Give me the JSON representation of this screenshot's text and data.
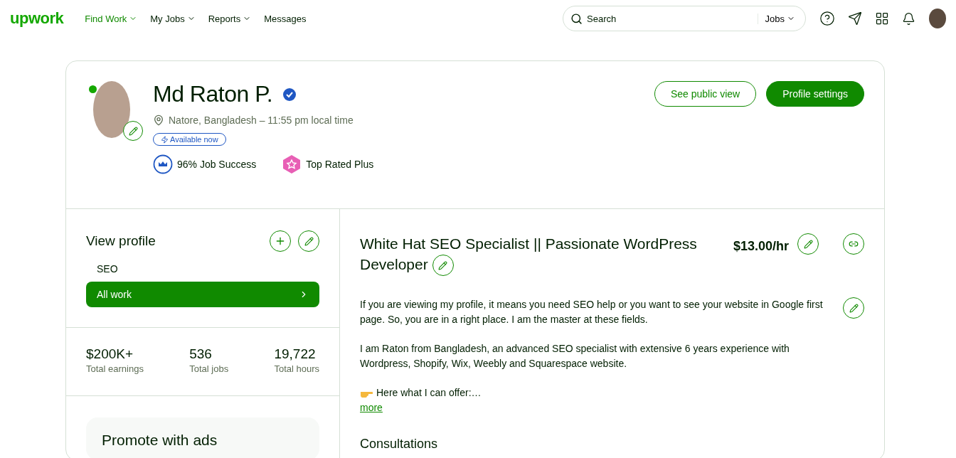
{
  "logo": "upwork",
  "nav": [
    {
      "label": "Find Work",
      "selected": true,
      "has_menu": true
    },
    {
      "label": "My Jobs",
      "selected": false,
      "has_menu": true
    },
    {
      "label": "Reports",
      "selected": false,
      "has_menu": true
    },
    {
      "label": "Messages",
      "selected": false,
      "has_menu": false
    }
  ],
  "search": {
    "placeholder": "Search",
    "scope": "Jobs"
  },
  "profile": {
    "name": "Md Raton P.",
    "online": true,
    "verified": true,
    "location": "Natore, Bangladesh – 11:55 pm local time",
    "availability": "Available now",
    "job_success": "96% Job Success",
    "badge": "Top Rated Plus"
  },
  "header_buttons": [
    {
      "label": "See public view",
      "kind": "outline"
    },
    {
      "label": "Profile settings",
      "kind": "primary"
    }
  ],
  "sidebar": {
    "title": "View profile",
    "items": [
      {
        "label": "SEO",
        "selected": false
      },
      {
        "label": "All work",
        "selected": true
      }
    ],
    "stats": [
      {
        "value": "$200K+",
        "label": "Total earnings"
      },
      {
        "value": "536",
        "label": "Total jobs"
      },
      {
        "value": "19,722",
        "label": "Total hours"
      }
    ],
    "promo_title": "Promote with ads"
  },
  "main": {
    "title": "White Hat SEO Specialist || Passionate WordPress Developer",
    "rate": "$13.00/hr",
    "paragraphs": [
      "If you are viewing my profile, it means you need SEO help or you want to see your website in Google first page. So, you are in a right place. I am the master at these fields.",
      "I am Raton from Bangladesh, an advanced SEO specialist with extensive 6 years experience with Wordpress, Shopify, Wix, Weebly and Squarespace website.",
      "Here what I can offer:…"
    ],
    "more": "more",
    "section": "Consultations"
  }
}
